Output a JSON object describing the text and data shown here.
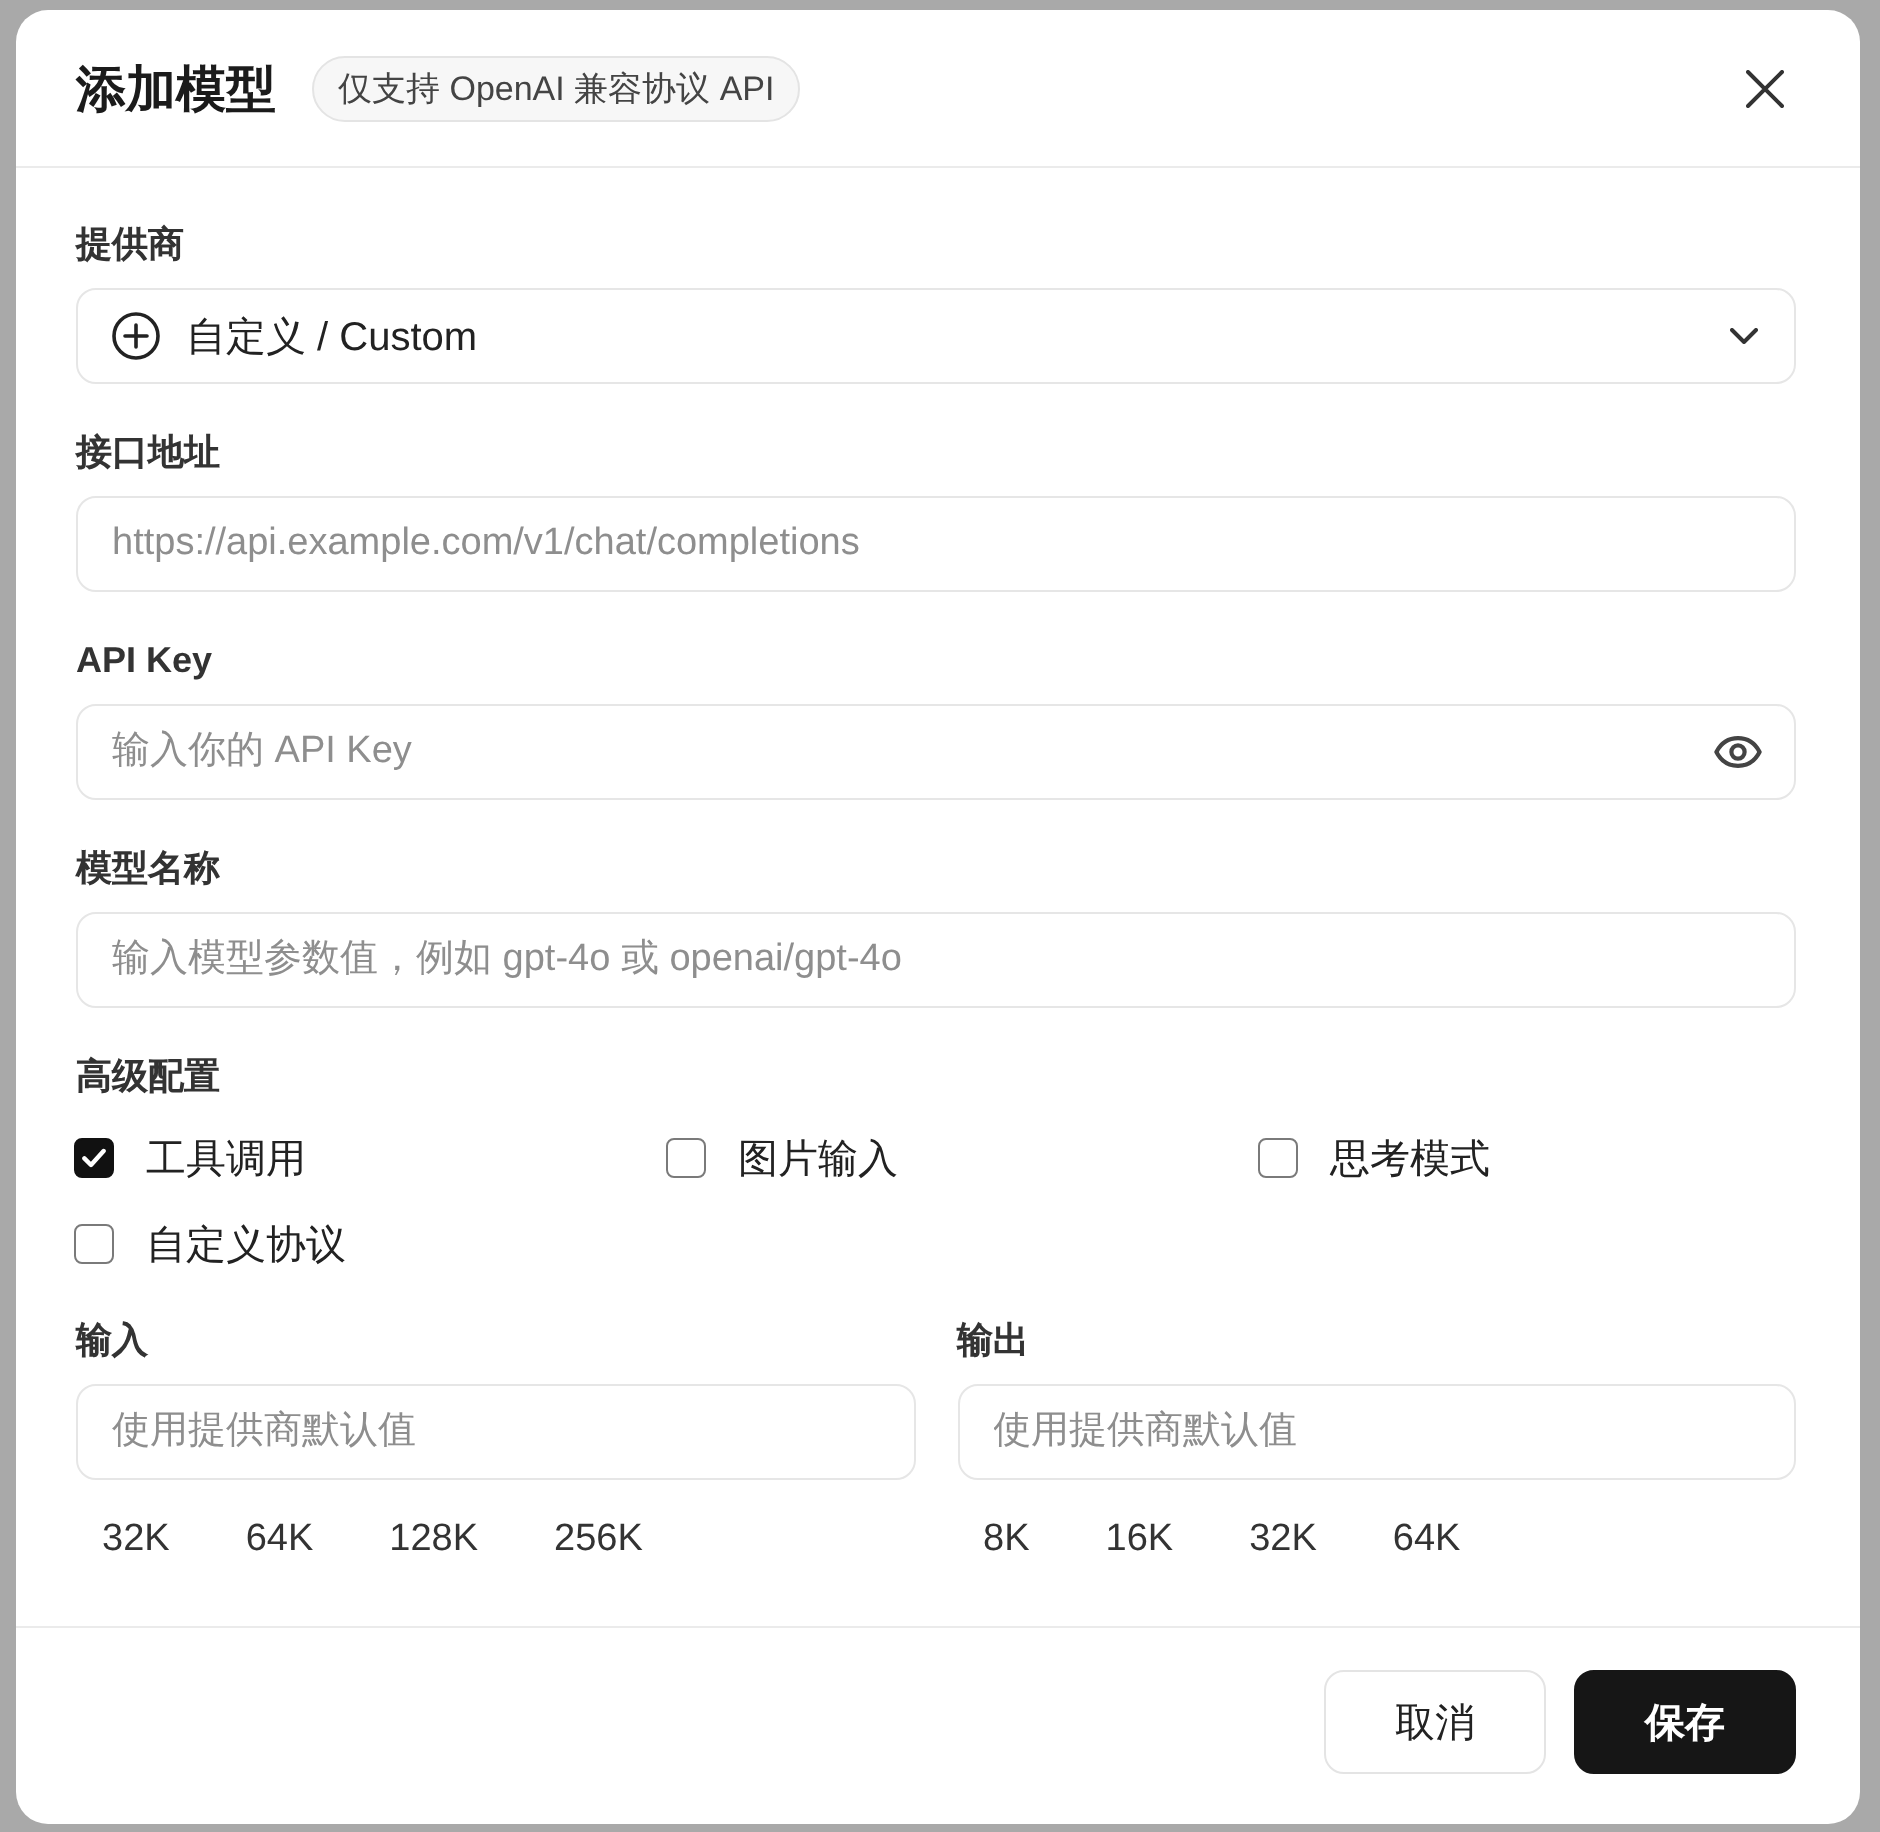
{
  "dialog": {
    "title": "添加模型",
    "badge": "仅支持 OpenAI 兼容协议 API"
  },
  "fields": [
    {
      "kind": "select",
      "label": "提供商",
      "value": "自定义 / Custom"
    },
    {
      "kind": "url",
      "label": "接口地址",
      "placeholder": "https://api.example.com/v1/chat/completions"
    },
    {
      "kind": "secret",
      "label": "API Key",
      "placeholder": "输入你的 API Key"
    },
    {
      "kind": "text",
      "label": "模型名称",
      "placeholder": "输入模型参数值，例如 gpt-4o 或 openai/gpt-4o"
    }
  ],
  "advanced": {
    "label": "高级配置",
    "options": [
      {
        "label": "工具调用",
        "checked": true
      },
      {
        "label": "图片输入",
        "checked": false
      },
      {
        "label": "思考模式",
        "checked": false
      },
      {
        "label": "自定义协议",
        "checked": false
      }
    ]
  },
  "limits": [
    {
      "label": "输入",
      "placeholder": "使用提供商默认值",
      "presets": [
        "32K",
        "64K",
        "128K",
        "256K"
      ]
    },
    {
      "label": "输出",
      "placeholder": "使用提供商默认值",
      "presets": [
        "8K",
        "16K",
        "32K",
        "64K"
      ]
    }
  ],
  "buttons": [
    {
      "kind": "secondary",
      "label": "取消"
    },
    {
      "kind": "primary",
      "label": "保存"
    }
  ]
}
